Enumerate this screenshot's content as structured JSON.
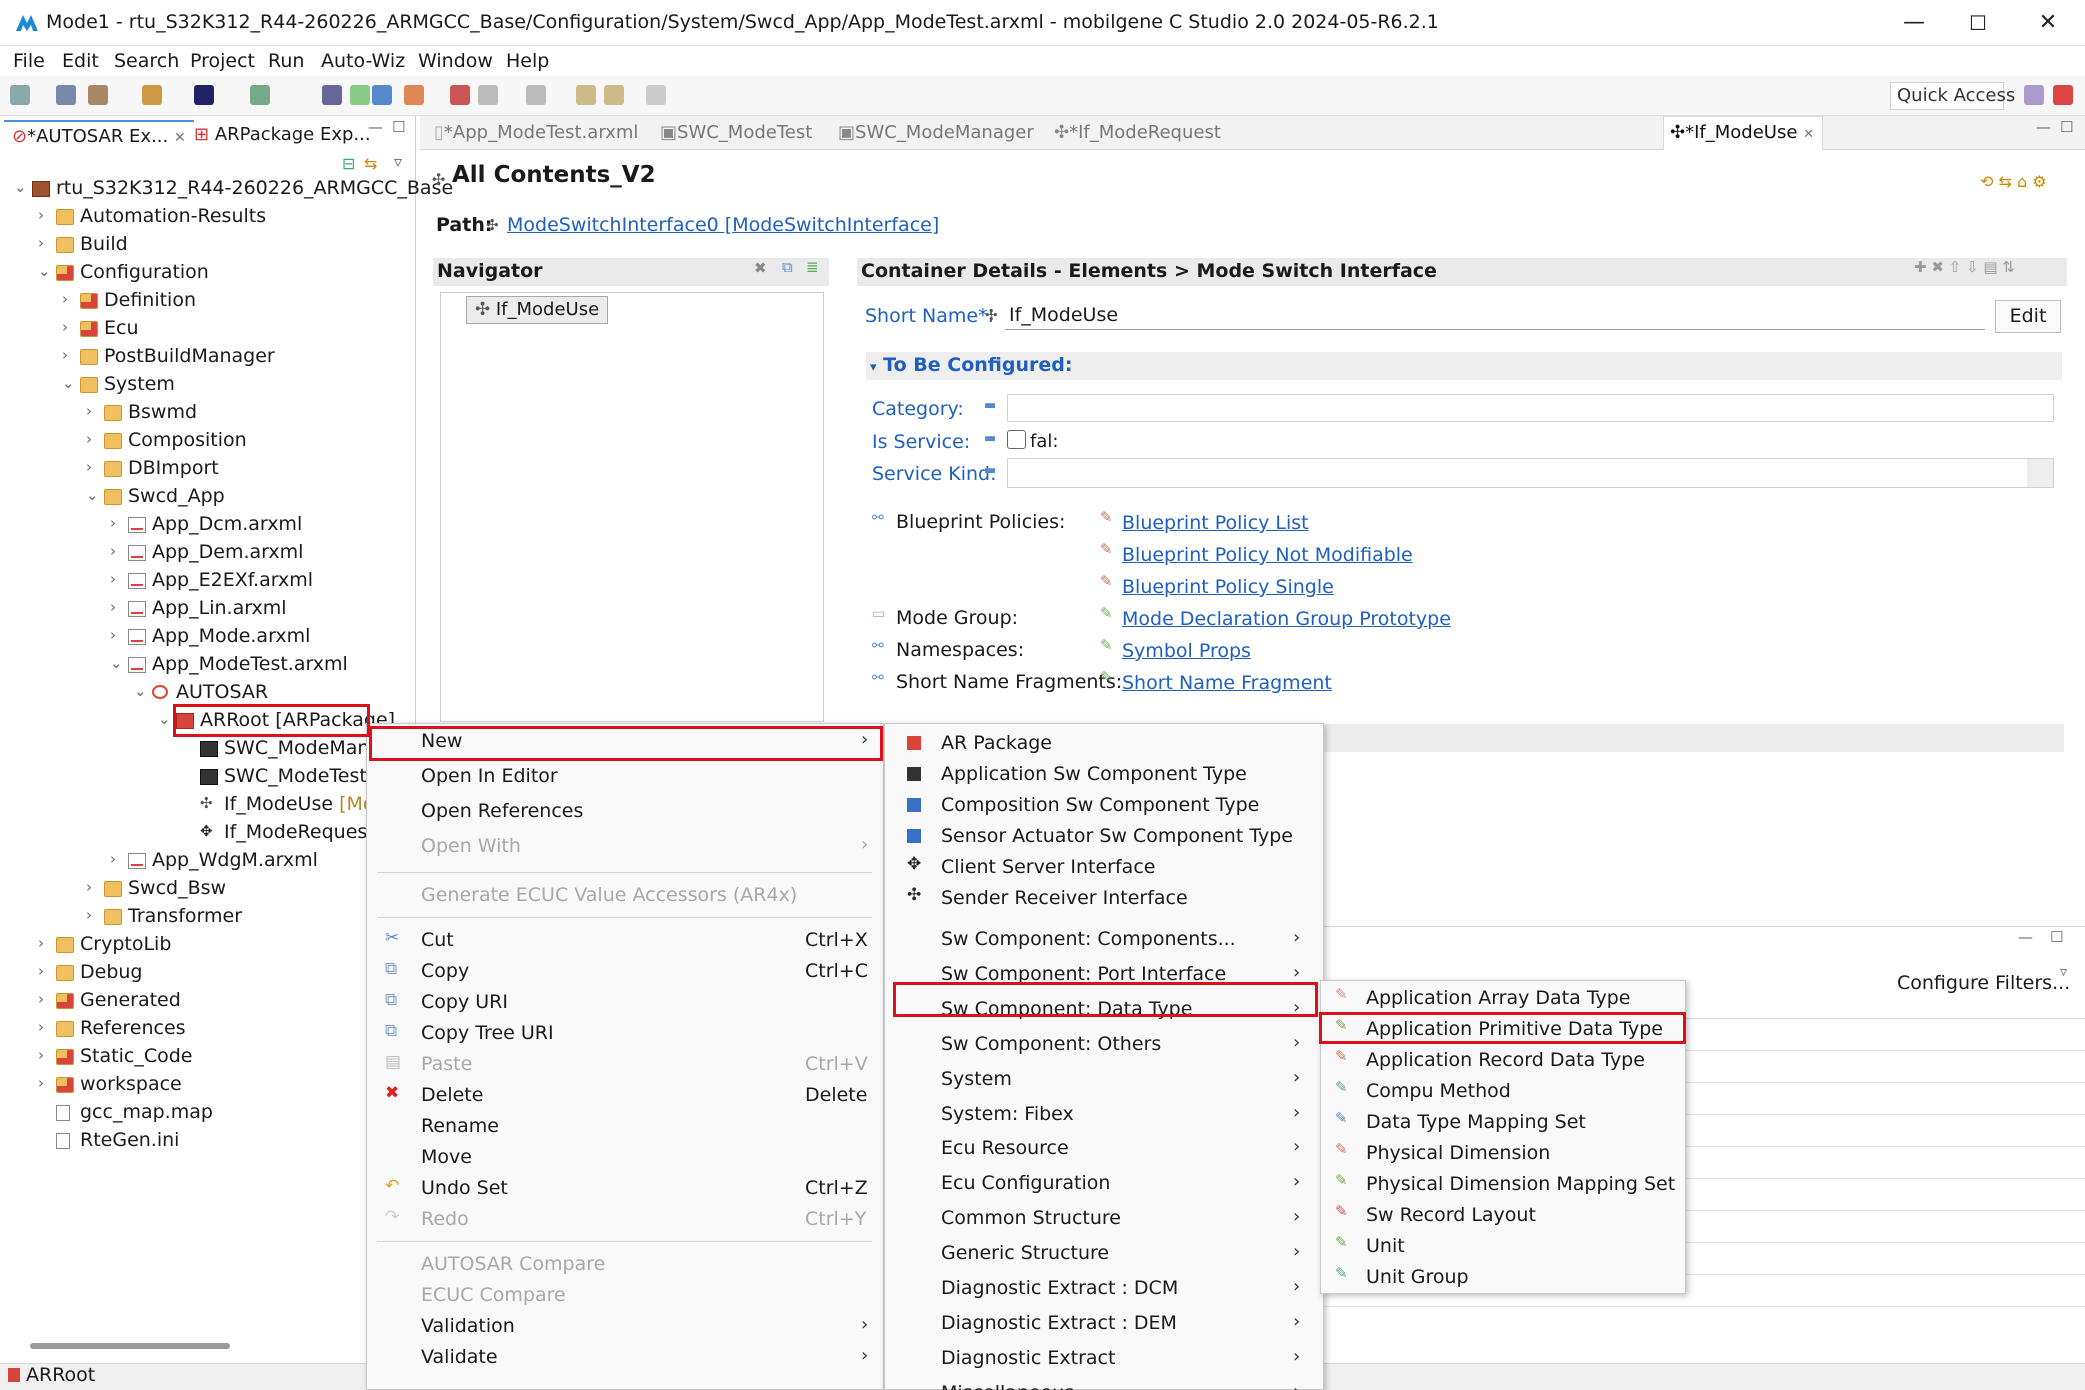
{
  "window": {
    "title": "Mode1 - rtu_S32K312_R44-260226_ARMGCC_Base/Configuration/System/Swcd_App/App_ModeTest.arxml - mobilgene C Studio 2.0 2024-05-R6.2.1",
    "minimize": "—",
    "maximize": "☐",
    "close": "✕"
  },
  "menubar": [
    "File",
    "Edit",
    "Search",
    "Project",
    "Run",
    "Auto-Wiz",
    "Window",
    "Help"
  ],
  "toolbar": {
    "quick_access": "Quick Access"
  },
  "left_panel": {
    "tabs": [
      "*AUTOSAR Ex...",
      "ARPackage Exp..."
    ],
    "tree": [
      {
        "label": "rtu_S32K312_R44-260226_ARMGCC_Base",
        "depth": 0,
        "chev": "⌄",
        "icon": "project"
      },
      {
        "label": "Automation-Results",
        "depth": 1,
        "chev": "›",
        "icon": "folder"
      },
      {
        "label": "Build",
        "depth": 1,
        "chev": "›",
        "icon": "folder"
      },
      {
        "label": "Configuration",
        "depth": 1,
        "chev": "⌄",
        "icon": "folder-red"
      },
      {
        "label": "Definition",
        "depth": 2,
        "chev": "›",
        "icon": "folder-red"
      },
      {
        "label": "Ecu",
        "depth": 2,
        "chev": "›",
        "icon": "folder-red"
      },
      {
        "label": "PostBuildManager",
        "depth": 2,
        "chev": "›",
        "icon": "folder"
      },
      {
        "label": "System",
        "depth": 2,
        "chev": "⌄",
        "icon": "folder"
      },
      {
        "label": "Bswmd",
        "depth": 3,
        "chev": "›",
        "icon": "folder"
      },
      {
        "label": "Composition",
        "depth": 3,
        "chev": "›",
        "icon": "folder"
      },
      {
        "label": "DBImport",
        "depth": 3,
        "chev": "›",
        "icon": "folder"
      },
      {
        "label": "Swcd_App",
        "depth": 3,
        "chev": "⌄",
        "icon": "folder"
      },
      {
        "label": "App_Dcm.arxml",
        "depth": 4,
        "chev": "›",
        "icon": "file"
      },
      {
        "label": "App_Dem.arxml",
        "depth": 4,
        "chev": "›",
        "icon": "file"
      },
      {
        "label": "App_E2EXf.arxml",
        "depth": 4,
        "chev": "›",
        "icon": "file"
      },
      {
        "label": "App_Lin.arxml",
        "depth": 4,
        "chev": "›",
        "icon": "file"
      },
      {
        "label": "App_Mode.arxml",
        "depth": 4,
        "chev": "›",
        "icon": "file"
      },
      {
        "label": "App_ModeTest.arxml",
        "depth": 4,
        "chev": "⌄",
        "icon": "file"
      },
      {
        "label": "AUTOSAR",
        "depth": 5,
        "chev": "⌄",
        "icon": "autosar"
      },
      {
        "label": "ARRoot [ARPackage]",
        "depth": 6,
        "chev": "⌄",
        "icon": "pkg"
      },
      {
        "label": "SWC_ModeManager",
        "depth": 7,
        "chev": "",
        "icon": "swc"
      },
      {
        "label": "SWC_ModeTest [A",
        "depth": 7,
        "chev": "",
        "icon": "swc"
      },
      {
        "label": "If_ModeUse [Mo",
        "depth": 7,
        "chev": "",
        "icon": "if"
      },
      {
        "label": "If_ModeRequest [",
        "depth": 7,
        "chev": "",
        "icon": "if2"
      },
      {
        "label": "App_WdgM.arxml",
        "depth": 4,
        "chev": "›",
        "icon": "file"
      },
      {
        "label": "Swcd_Bsw",
        "depth": 3,
        "chev": "›",
        "icon": "folder"
      },
      {
        "label": "Transformer",
        "depth": 3,
        "chev": "›",
        "icon": "folder"
      },
      {
        "label": "CryptoLib",
        "depth": 1,
        "chev": "›",
        "icon": "folder"
      },
      {
        "label": "Debug",
        "depth": 1,
        "chev": "›",
        "icon": "folder"
      },
      {
        "label": "Generated",
        "depth": 1,
        "chev": "›",
        "icon": "folder-red"
      },
      {
        "label": "References",
        "depth": 1,
        "chev": "›",
        "icon": "folder"
      },
      {
        "label": "Static_Code",
        "depth": 1,
        "chev": "›",
        "icon": "folder-red"
      },
      {
        "label": "workspace",
        "depth": 1,
        "chev": "›",
        "icon": "folder-red"
      },
      {
        "label": "gcc_map.map",
        "depth": 1,
        "chev": "",
        "icon": "plainfile"
      },
      {
        "label": "RteGen.ini",
        "depth": 1,
        "chev": "",
        "icon": "plainfile"
      }
    ]
  },
  "editor": {
    "tabs": [
      "*App_ModeTest.arxml",
      "SWC_ModeTest",
      "SWC_ModeManager",
      "*If_ModeRequest",
      "*If_ModeUse"
    ],
    "heading": "All Contents_V2",
    "path_label": "Path:",
    "path_link": "ModeSwitchInterface0 [ModeSwitchInterface]",
    "navigator": {
      "title": "Navigator",
      "node": "If_ModeUse"
    },
    "details": {
      "title": "Container Details - Elements > Mode Switch Interface",
      "short_name_label": "Short Name*:",
      "short_name_value": "If_ModeUse",
      "edit_button": "Edit",
      "section": "To Be Configured:",
      "category_label": "Category:",
      "is_service_label": "Is Service:",
      "is_service_value": "fal:",
      "service_kind_label": "Service Kind:",
      "blueprint_label": "Blueprint Policies:",
      "blueprint_links": [
        "Blueprint Policy List",
        "Blueprint Policy Not Modifiable",
        "Blueprint Policy Single"
      ],
      "mode_group_label": "Mode Group:",
      "mode_group_link": "Mode Declaration Group Prototype",
      "namespaces_label": "Namespaces:",
      "namespaces_link": "Symbol Props",
      "snf_label": "Short Name Fragments:",
      "snf_link": "Short Name Fragment"
    },
    "configure_filters": "Configure Filters..."
  },
  "context_menu": {
    "items": [
      {
        "label": "New",
        "shortcut": "",
        "submenu": true,
        "disabled": false,
        "icon": ""
      },
      {
        "label": "Open In Editor",
        "shortcut": "",
        "submenu": false,
        "disabled": false,
        "icon": ""
      },
      {
        "label": "Open References",
        "shortcut": "",
        "submenu": false,
        "disabled": false,
        "icon": ""
      },
      {
        "label": "Open With",
        "shortcut": "",
        "submenu": true,
        "disabled": true,
        "icon": ""
      },
      {
        "sep": true
      },
      {
        "label": "Generate ECUC Value Accessors (AR4x)",
        "shortcut": "",
        "submenu": false,
        "disabled": true,
        "icon": ""
      },
      {
        "sep": true
      },
      {
        "label": "Cut",
        "shortcut": "Ctrl+X",
        "submenu": false,
        "disabled": false,
        "icon": "cut"
      },
      {
        "label": "Copy",
        "shortcut": "Ctrl+C",
        "submenu": false,
        "disabled": false,
        "icon": "copy"
      },
      {
        "label": "Copy URI",
        "shortcut": "",
        "submenu": false,
        "disabled": false,
        "icon": "copy"
      },
      {
        "label": "Copy Tree URI",
        "shortcut": "",
        "submenu": false,
        "disabled": false,
        "icon": "copy"
      },
      {
        "label": "Paste",
        "shortcut": "Ctrl+V",
        "submenu": false,
        "disabled": true,
        "icon": "paste"
      },
      {
        "label": "Delete",
        "shortcut": "Delete",
        "submenu": false,
        "disabled": false,
        "icon": "delete"
      },
      {
        "label": "Rename",
        "shortcut": "",
        "submenu": false,
        "disabled": false,
        "icon": ""
      },
      {
        "label": "Move",
        "shortcut": "",
        "submenu": false,
        "disabled": false,
        "icon": ""
      },
      {
        "label": "Undo Set",
        "shortcut": "Ctrl+Z",
        "submenu": false,
        "disabled": false,
        "icon": "undo"
      },
      {
        "label": "Redo",
        "shortcut": "Ctrl+Y",
        "submenu": false,
        "disabled": true,
        "icon": "redo"
      },
      {
        "sep": true
      },
      {
        "label": "AUTOSAR Compare",
        "shortcut": "",
        "submenu": false,
        "disabled": true,
        "icon": ""
      },
      {
        "label": "ECUC Compare",
        "shortcut": "",
        "submenu": false,
        "disabled": true,
        "icon": ""
      },
      {
        "label": "Validation",
        "shortcut": "",
        "submenu": true,
        "disabled": false,
        "icon": ""
      },
      {
        "label": "Validate",
        "shortcut": "",
        "submenu": true,
        "disabled": false,
        "icon": ""
      }
    ]
  },
  "new_submenu": {
    "items": [
      {
        "label": "AR Package",
        "submenu": false,
        "icon": "pkg"
      },
      {
        "label": "Application Sw Component Type",
        "submenu": false,
        "icon": "swc"
      },
      {
        "label": "Composition Sw Component Type",
        "submenu": false,
        "icon": "comp"
      },
      {
        "label": "Sensor Actuator Sw Component Type",
        "submenu": false,
        "icon": "comp"
      },
      {
        "label": "Client Server Interface",
        "submenu": false,
        "icon": "cs"
      },
      {
        "label": "Sender Receiver Interface",
        "submenu": false,
        "icon": "sr"
      },
      {
        "label": "Sw Component: Components...",
        "submenu": true,
        "icon": ""
      },
      {
        "label": "Sw Component: Port Interface",
        "submenu": true,
        "icon": ""
      },
      {
        "label": "Sw Component: Data Type",
        "submenu": true,
        "icon": ""
      },
      {
        "label": "Sw Component: Others",
        "submenu": true,
        "icon": ""
      },
      {
        "label": "System",
        "submenu": true,
        "icon": ""
      },
      {
        "label": "System: Fibex",
        "submenu": true,
        "icon": ""
      },
      {
        "label": "Ecu Resource",
        "submenu": true,
        "icon": ""
      },
      {
        "label": "Ecu Configuration",
        "submenu": true,
        "icon": ""
      },
      {
        "label": "Common Structure",
        "submenu": true,
        "icon": ""
      },
      {
        "label": "Generic Structure",
        "submenu": true,
        "icon": ""
      },
      {
        "label": "Diagnostic Extract : DCM",
        "submenu": true,
        "icon": ""
      },
      {
        "label": "Diagnostic Extract : DEM",
        "submenu": true,
        "icon": ""
      },
      {
        "label": "Diagnostic Extract",
        "submenu": true,
        "icon": ""
      },
      {
        "label": "Miscellaneous",
        "submenu": true,
        "icon": ""
      }
    ]
  },
  "datatype_submenu": {
    "items": [
      "Application Array Data Type",
      "Application Primitive Data Type",
      "Application Record Data Type",
      "Compu Method",
      "Data Type Mapping Set",
      "Physical Dimension",
      "Physical Dimension Mapping Set",
      "Sw Record Layout",
      "Unit",
      "Unit Group"
    ]
  },
  "status_bar": {
    "text": "ARRoot"
  }
}
